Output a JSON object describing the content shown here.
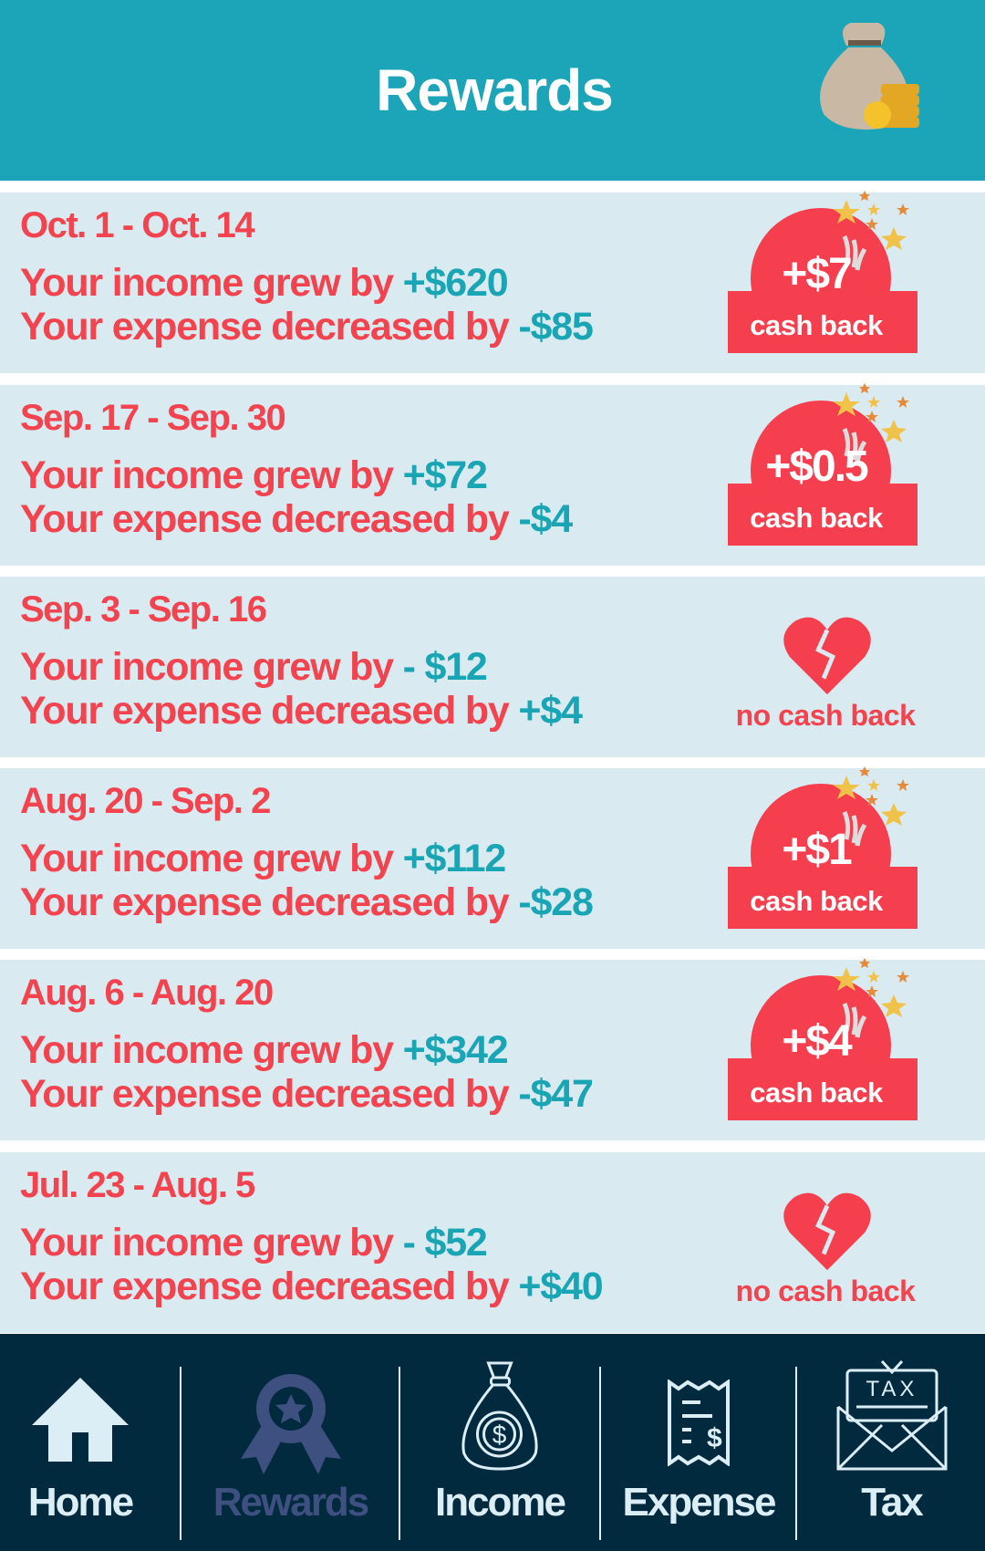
{
  "header": {
    "title": "Rewards",
    "icon": "money-bag-icon"
  },
  "colors": {
    "header": "#1ca5b8",
    "card": "#d9eaf1",
    "red": "#f53f4f",
    "teal": "#1aa5b5",
    "nav": "#022a3e",
    "active": "#3e5080"
  },
  "cards": [
    {
      "date": "Oct. 1 - Oct. 14",
      "income_label": "Your income grew by ",
      "income": "+$620",
      "expense_label": "Your expense decreased by ",
      "expense": "-$85",
      "reward": "+$7",
      "reward_label": "cash back"
    },
    {
      "date": "Sep. 17 - Sep. 30",
      "income_label": "Your income grew by ",
      "income": "+$72",
      "expense_label": "Your expense decreased by ",
      "expense": "-$4",
      "reward": "+$0.5",
      "reward_label": "cash back"
    },
    {
      "date": "Sep. 3 - Sep. 16",
      "income_label": "Your income grew by ",
      "income": "- $12",
      "expense_label": "Your expense decreased by ",
      "expense": "+$4",
      "reward_label": "no cash back"
    },
    {
      "date": "Aug. 20 - Sep. 2",
      "income_label": "Your income grew by ",
      "income": "+$112",
      "expense_label": "Your expense decreased by ",
      "expense": "-$28",
      "reward": "+$1",
      "reward_label": "cash back"
    },
    {
      "date": "Aug. 6 - Aug. 20",
      "income_label": "Your income grew by ",
      "income": "+$342",
      "expense_label": "Your expense decreased by ",
      "expense": "-$47",
      "reward": "+$4",
      "reward_label": "cash back"
    },
    {
      "date": "Jul. 23 - Aug. 5",
      "income_label": "Your income grew by ",
      "income": "- $52",
      "expense_label": "Your expense decreased by ",
      "expense": "+$40",
      "reward_label": "no cash back"
    }
  ],
  "nav": [
    {
      "label": "Home"
    },
    {
      "label": "Rewards",
      "active": true
    },
    {
      "label": "Income"
    },
    {
      "label": "Expense"
    },
    {
      "label": "Tax"
    }
  ]
}
